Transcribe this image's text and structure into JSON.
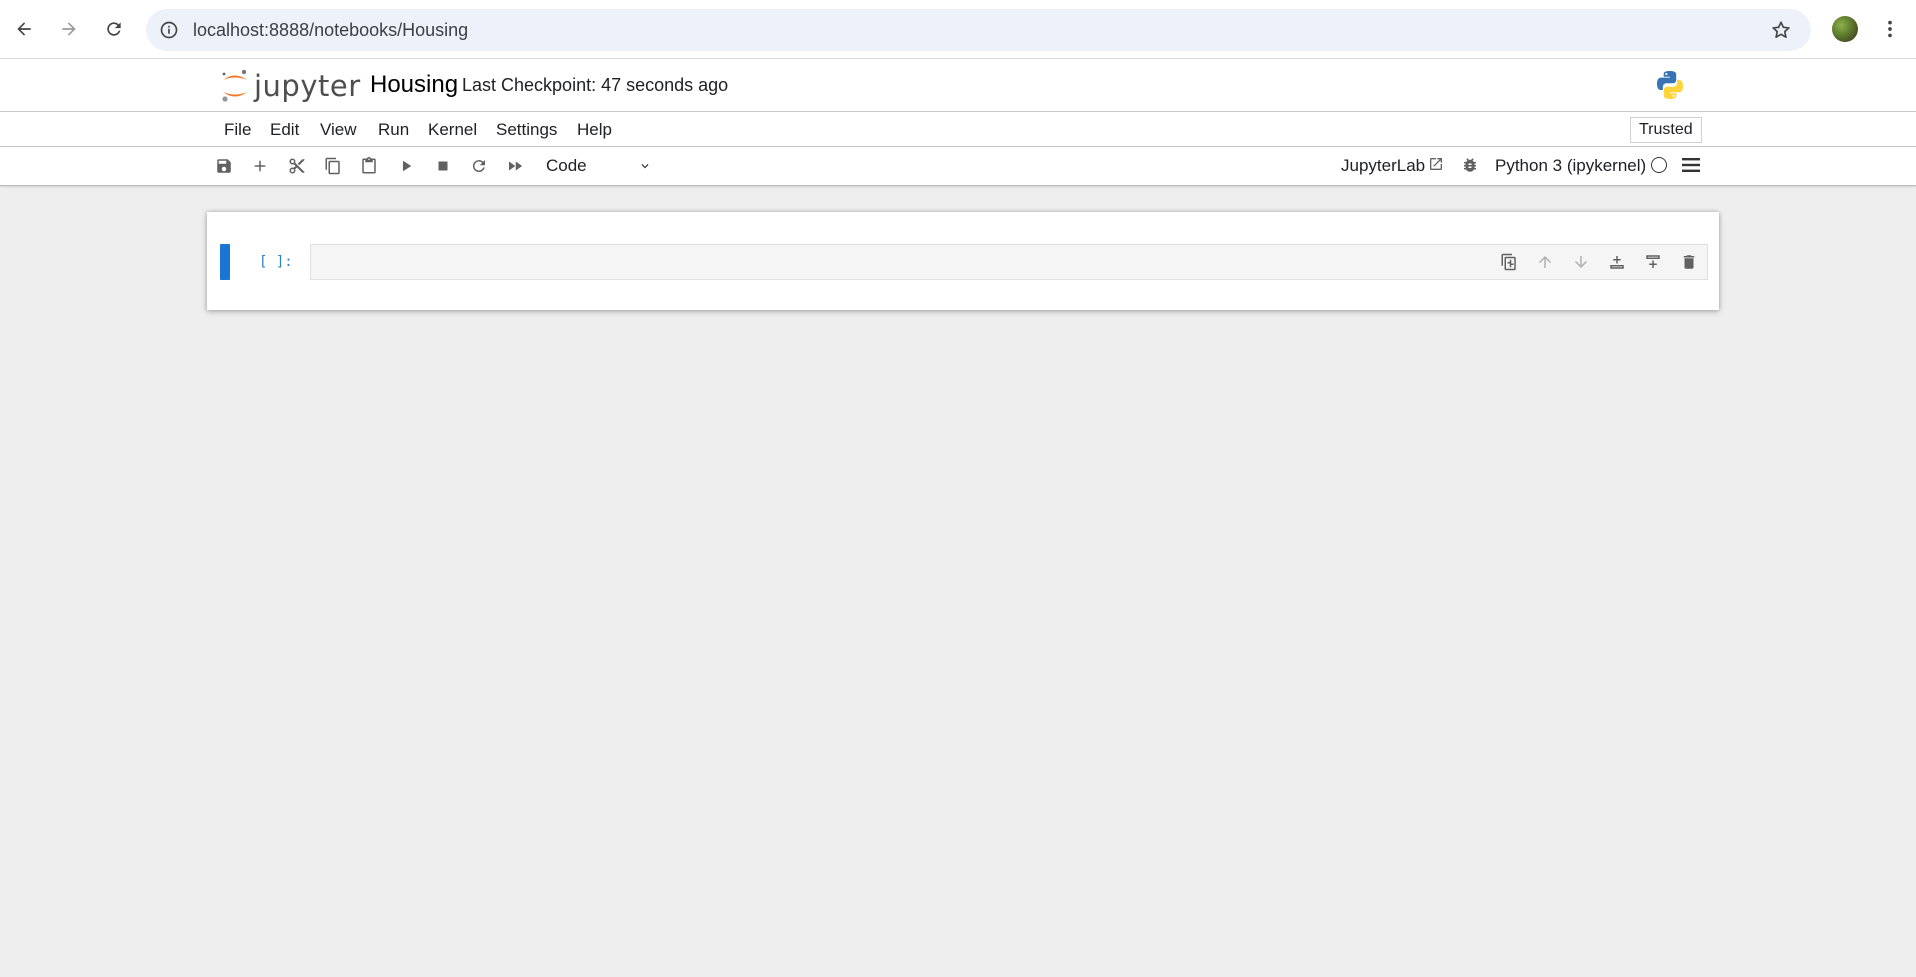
{
  "browser": {
    "url": "localhost:8888/notebooks/Housing"
  },
  "header": {
    "logo_text": "jupyter",
    "notebook_title": "Housing",
    "checkpoint": "Last Checkpoint: 47 seconds ago"
  },
  "menu": {
    "items": [
      "File",
      "Edit",
      "View",
      "Run",
      "Kernel",
      "Settings",
      "Help"
    ],
    "trusted": "Trusted"
  },
  "toolbar": {
    "cell_type": "Code",
    "jupyterlab_link": "JupyterLab",
    "kernel_name": "Python 3 (ipykernel)",
    "icons": [
      "save-icon",
      "add-icon",
      "cut-icon",
      "copy-icon",
      "paste-icon",
      "run-icon",
      "stop-icon",
      "restart-icon",
      "fast-forward-icon"
    ]
  },
  "cell": {
    "prompt": "[ ]:",
    "content": "",
    "tools": [
      "duplicate-icon",
      "move-up-icon",
      "move-down-icon",
      "insert-above-icon",
      "insert-below-icon",
      "delete-icon"
    ]
  },
  "colors": {
    "accent": "#1976d2",
    "jupyter_orange": "#f37726",
    "background": "#eeeeee"
  }
}
